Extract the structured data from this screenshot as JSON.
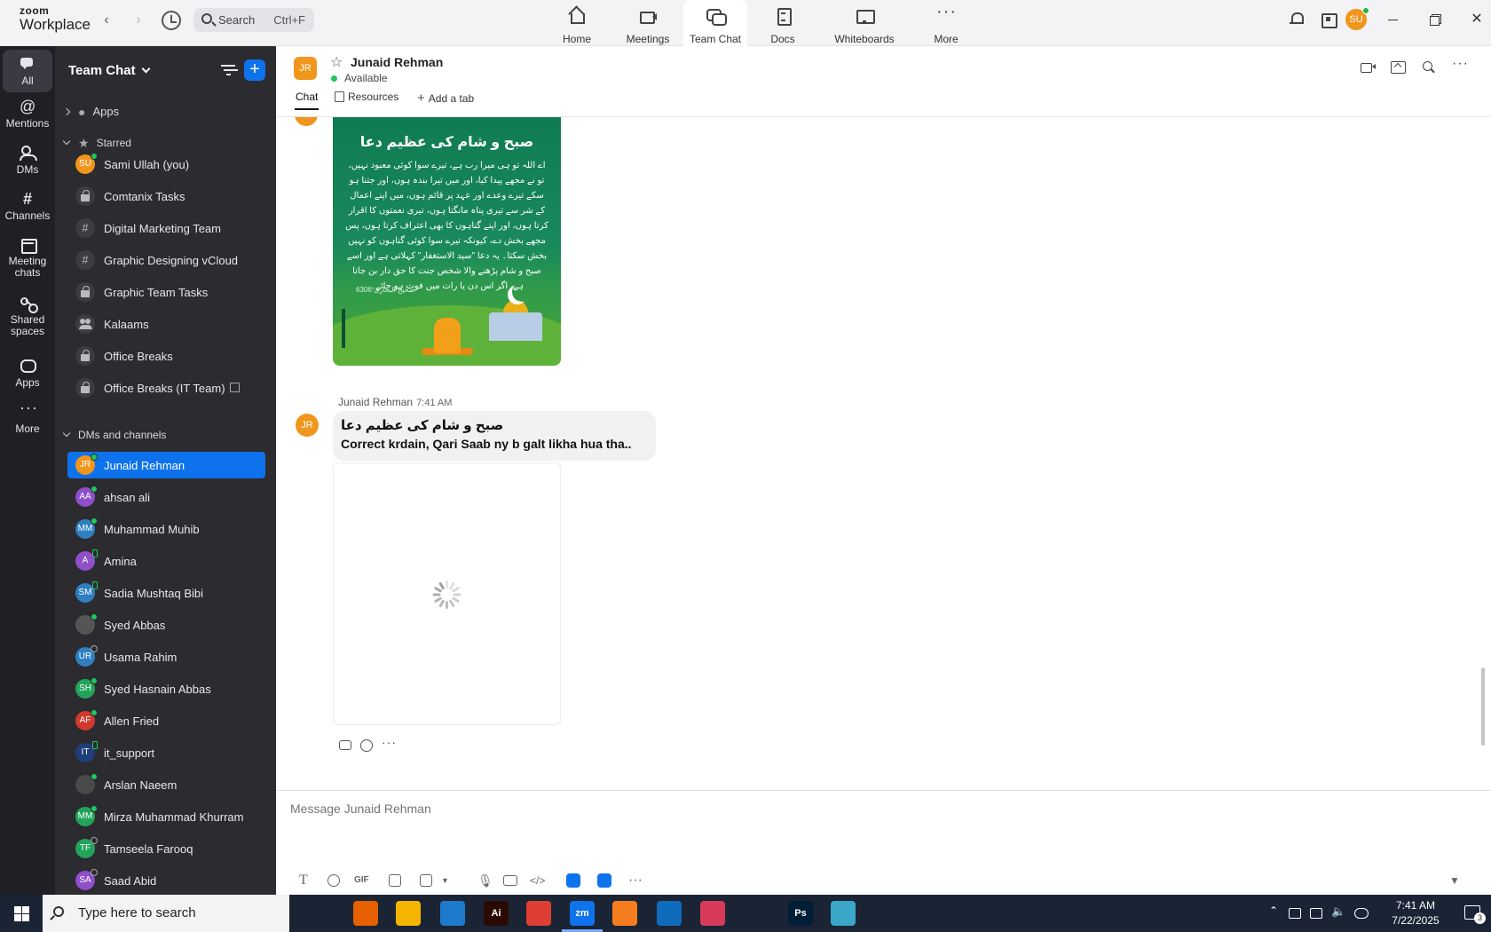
{
  "app": {
    "brand_line1": "zoom",
    "brand_line2": "Workplace",
    "search_placeholder": "Search",
    "search_shortcut": "Ctrl+F",
    "user_initials": "SU"
  },
  "nav_tabs": [
    {
      "label": "Home",
      "icon": "home-icon"
    },
    {
      "label": "Meetings",
      "icon": "video-camera-icon"
    },
    {
      "label": "Team Chat",
      "icon": "chat-bubbles-icon",
      "active": true
    },
    {
      "label": "Docs",
      "icon": "document-icon"
    },
    {
      "label": "Whiteboards",
      "icon": "whiteboard-icon"
    },
    {
      "label": "More",
      "icon": "more-dots-icon"
    }
  ],
  "rail": [
    {
      "label": "All",
      "active": true
    },
    {
      "label": "Mentions"
    },
    {
      "label": "DMs"
    },
    {
      "label": "Channels"
    },
    {
      "label": "Meeting chats"
    },
    {
      "label": "Shared spaces"
    },
    {
      "label": "Apps"
    },
    {
      "label": "More"
    }
  ],
  "sidebar": {
    "title": "Team Chat",
    "apps_label": "Apps",
    "starred_label": "Starred",
    "dms_label": "DMs and channels",
    "starred": [
      {
        "label": "Sami Ullah (you)",
        "initials": "SU",
        "color": "#f0961d",
        "status": "online"
      },
      {
        "label": "Comtanix Tasks",
        "kind": "lock"
      },
      {
        "label": "Digital Marketing Team",
        "kind": "hash"
      },
      {
        "label": "Graphic Designing vCloud",
        "kind": "hash"
      },
      {
        "label": "Graphic Team Tasks",
        "kind": "lock"
      },
      {
        "label": "Kalaams",
        "kind": "people"
      },
      {
        "label": "Office Breaks",
        "kind": "lock"
      },
      {
        "label": "Office Breaks (IT Team)",
        "kind": "lock",
        "archived": true
      }
    ],
    "dms": [
      {
        "label": "Junaid Rehman",
        "initials": "JR",
        "color": "#f0961d",
        "status": "online",
        "active": true
      },
      {
        "label": "ahsan ali",
        "initials": "AA",
        "color": "#8e4fc9",
        "status": "online"
      },
      {
        "label": "Muhammad Muhib",
        "initials": "MM",
        "color": "#2f7fc1",
        "status": "online"
      },
      {
        "label": "Amina",
        "initials": "A",
        "color": "#8e4fc9",
        "status": "mobile"
      },
      {
        "label": "Sadia Mushtaq Bibi",
        "initials": "SM",
        "color": "#2f7fc1",
        "status": "mobile"
      },
      {
        "label": "Syed Abbas",
        "initials": "",
        "color": "#555555",
        "status": "online"
      },
      {
        "label": "Usama Rahim",
        "initials": "UR",
        "color": "#2f7fc1",
        "status": "away"
      },
      {
        "label": "Syed Hasnain Abbas",
        "initials": "SH",
        "color": "#23a35a",
        "status": "online"
      },
      {
        "label": "Allen Fried",
        "initials": "AF",
        "color": "#d0392e",
        "status": "online"
      },
      {
        "label": "it_support",
        "initials": "IT",
        "color": "#1f3f7a",
        "status": "mobile"
      },
      {
        "label": "Arslan Naeem",
        "initials": "",
        "color": "#4a4a4a",
        "status": "online"
      },
      {
        "label": "Mirza Muhammad Khurram",
        "initials": "MM",
        "color": "#23a35a",
        "status": "online"
      },
      {
        "label": "Tamseela Farooq",
        "initials": "TF",
        "color": "#23a35a",
        "status": "away"
      },
      {
        "label": "Saad Abid",
        "initials": "SA",
        "color": "#8e4fc9",
        "status": "away"
      }
    ]
  },
  "chat": {
    "contact_name": "Junaid Rehman",
    "contact_initials": "JR",
    "contact_status": "Available",
    "tabs": {
      "chat": "Chat",
      "resources": "Resources",
      "add": "Add a tab"
    },
    "image_title": "صبح و شام کی عظیم دعا",
    "image_body": "اے اللہ تو ہی میرا رب ہے، تیرے سوا کوئی معبود نہیں، تو نے مجھے پیدا کیا، اور میں تیرا بندہ ہوں، اور جتنا ہو سکے تیرے وعدے اور عہد پر قائم ہوں، میں اپنے اعمال کے شر سے تیری پناہ مانگتا ہوں، تیری نعمتوں کا اقرار کرتا ہوں، اور اپنے گناہوں کا بھی اعتراف کرتا ہوں، پس مجھے بخش دے، کیونکہ تیرے سوا کوئی گناہوں کو نہیں بخش سکتا۔ یہ دعا \"سید الاستغفار\" کہلاتی ہے اور اسے صبح و شام پڑھنے والا شخص جنت کا حق دار بن جاتا ہے، اگر اس دن یا رات میں فوت ہو جائے۔",
    "image_ref": "صحیح البخاری 6306",
    "sender": "Junaid Rehman",
    "time": "7:41 AM",
    "message_urdu": "صبح و شام کی عظیم دعا",
    "message_text": "Correct krdain, Qari Saab ny b galt likha hua tha..",
    "composer_placeholder": "Message Junaid Rehman"
  },
  "taskbar": {
    "search_placeholder": "Type here to search",
    "time": "7:41 AM",
    "date": "7/22/2025",
    "notifications": "3",
    "apps": [
      {
        "name": "task-view",
        "color": "#1b2434",
        "label": ""
      },
      {
        "name": "firefox",
        "color": "#e66000",
        "label": ""
      },
      {
        "name": "file-explorer",
        "color": "#f4b400",
        "label": ""
      },
      {
        "name": "vscode",
        "color": "#1e7acc",
        "label": ""
      },
      {
        "name": "illustrator",
        "color": "#2a0a00",
        "label": "Ai"
      },
      {
        "name": "chrome",
        "color": "#dd3f34",
        "label": ""
      },
      {
        "name": "zoom",
        "color": "#0e72ed",
        "label": "zm",
        "active": true
      },
      {
        "name": "xampp",
        "color": "#f57d20",
        "label": ""
      },
      {
        "name": "outlook",
        "color": "#0f6cbd",
        "label": ""
      },
      {
        "name": "creative-cloud",
        "color": "#d83b5a",
        "label": ""
      },
      {
        "name": "pen-tool",
        "color": "#1b2434",
        "label": ""
      },
      {
        "name": "photoshop",
        "color": "#001e36",
        "label": "Ps"
      },
      {
        "name": "app-diamond",
        "color": "#3aa7c9",
        "label": ""
      }
    ]
  }
}
